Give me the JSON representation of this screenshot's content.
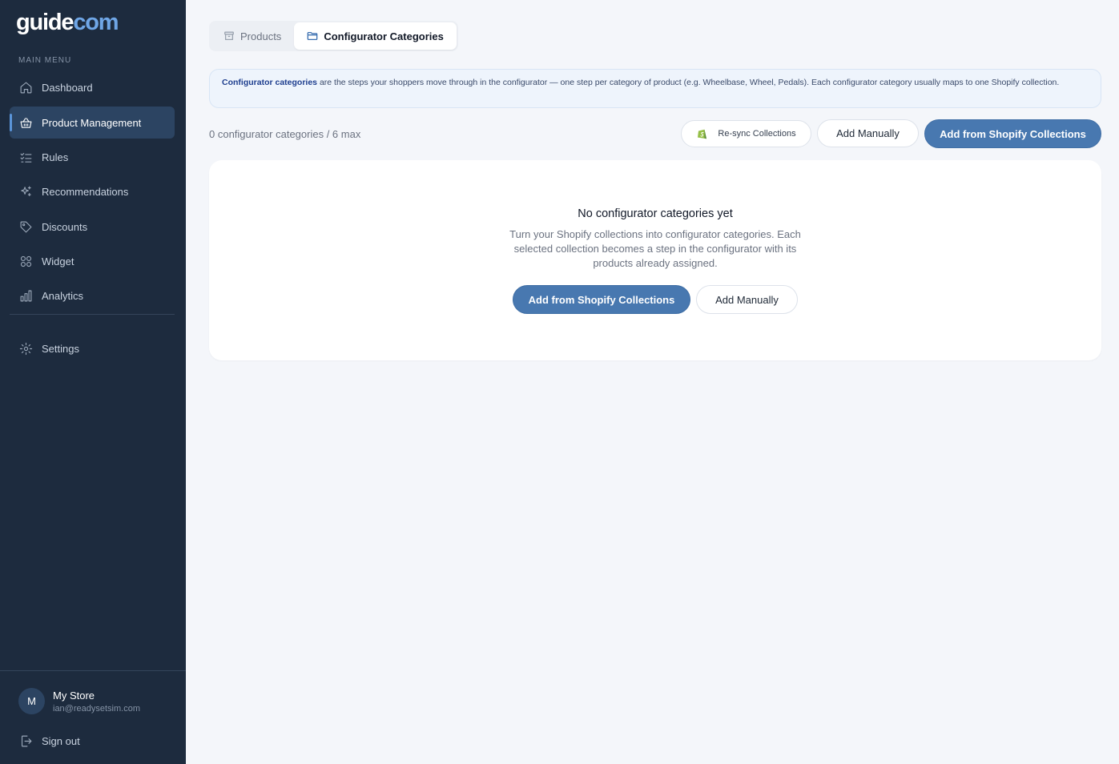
{
  "sidebar": {
    "logo": {
      "part1": "guide",
      "part2": "com"
    },
    "menu_heading": "MAIN MENU",
    "items": [
      {
        "label": "Dashboard",
        "icon": "home-icon"
      },
      {
        "label": "Product Management",
        "icon": "basket-icon",
        "active": true
      },
      {
        "label": "Rules",
        "icon": "checklist-icon"
      },
      {
        "label": "Recommendations",
        "icon": "sparkles-icon"
      },
      {
        "label": "Discounts",
        "icon": "tag-icon"
      },
      {
        "label": "Widget",
        "icon": "grid-icon"
      },
      {
        "label": "Analytics",
        "icon": "bar-chart-icon"
      }
    ],
    "settings_label": "Settings",
    "account": {
      "avatar_initial": "M",
      "store_name": "My Store",
      "email": "ian@readysetsim.com"
    },
    "sign_out_label": "Sign out"
  },
  "tabs": [
    {
      "label": "Products",
      "icon": "box-icon",
      "active": false
    },
    {
      "label": "Configurator Categories",
      "icon": "folder-icon",
      "active": true
    }
  ],
  "info_banner": {
    "bold": "Configurator categories",
    "text": " are the steps your shoppers move through in the configurator — one step per category of product (e.g. Wheelbase, Wheel, Pedals). Each configurator category usually maps to one Shopify collection."
  },
  "toolbar": {
    "count_text": "0 configurator categories / 6 max",
    "resync_label": "Re-sync Collections",
    "add_manually_label": "Add Manually",
    "add_shopify_label": "Add from Shopify Collections"
  },
  "empty_state": {
    "title": "No configurator categories yet",
    "description": "Turn your Shopify collections into configurator categories. Each selected collection becomes a step in the configurator with its products already assigned.",
    "add_shopify_label": "Add from Shopify Collections",
    "add_manually_label": "Add Manually"
  },
  "colors": {
    "sidebar_bg": "#1d2b3e",
    "accent": "#4878b0",
    "active_nav": "#2c4462",
    "shopify_green": "#95bf47"
  }
}
